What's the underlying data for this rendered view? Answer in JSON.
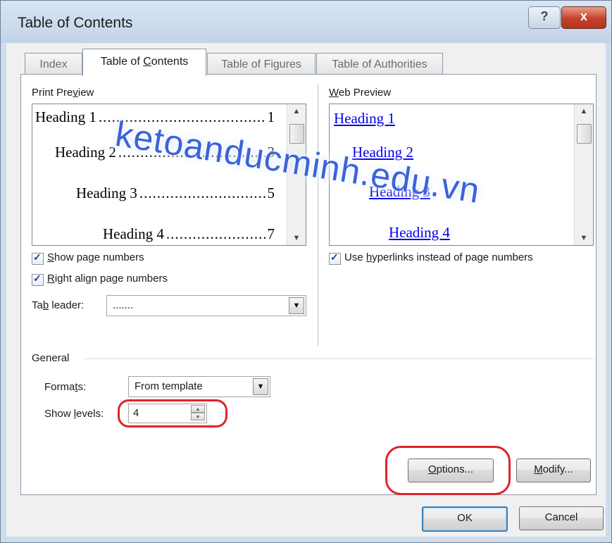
{
  "window": {
    "title": "Table of Contents",
    "help_glyph": "?",
    "close_glyph": "x"
  },
  "tabs": [
    {
      "label": "Index",
      "active": false
    },
    {
      "label_pre": "Table of ",
      "label_acc": "C",
      "label_post": "ontents",
      "active": true
    },
    {
      "label": "Table of Figures",
      "active": false
    },
    {
      "label": "Table of Authorities",
      "active": false
    }
  ],
  "print_preview": {
    "label_pre": "Print Pre",
    "label_acc": "v",
    "label_post": "iew",
    "rows": [
      {
        "text": "Heading 1",
        "dots": "...............................................",
        "page": "1"
      },
      {
        "text": "Heading 2",
        "dots": "...............................................",
        "page": "3"
      },
      {
        "text": "Heading 3",
        "dots": "...............................................",
        "page": "5"
      },
      {
        "text": "Heading 4",
        "dots": "...............................................",
        "page": "7"
      }
    ]
  },
  "web_preview": {
    "label_acc": "W",
    "label_post": "eb Preview",
    "rows": [
      "Heading 1",
      "Heading 2",
      "Heading 3",
      "Heading 4"
    ]
  },
  "options": {
    "show_page_numbers": {
      "acc": "S",
      "rest": "how page numbers",
      "checked": true
    },
    "right_align": {
      "acc": "R",
      "rest": "ight align page numbers",
      "checked": true
    },
    "use_hyperlinks": {
      "pre": "Use ",
      "acc": "h",
      "rest": "yperlinks instead of page numbers",
      "checked": true
    },
    "check_glyph": "✓",
    "tab_leader": {
      "pre": "Ta",
      "acc": "b",
      "post": " leader:",
      "value": "......."
    }
  },
  "general": {
    "legend": "General",
    "formats": {
      "pre": "Forma",
      "acc": "t",
      "post": "s:",
      "value": "From template"
    },
    "show_levels": {
      "pre": "Show ",
      "acc": "l",
      "post": "evels:",
      "value": "4"
    }
  },
  "buttons": {
    "options": {
      "acc": "O",
      "rest": "ptions..."
    },
    "modify": {
      "acc": "M",
      "rest": "odify..."
    },
    "ok": "OK",
    "cancel": "Cancel"
  },
  "icons": {
    "dropdown_arrow": "▼",
    "scroll_up": "▲",
    "scroll_down": "▼",
    "spin_up": "▲",
    "spin_down": "▼"
  },
  "watermark": "ketoanducminh.edu.vn",
  "colors": {
    "link": "#0000ee",
    "highlight": "#e0222a",
    "watermark": "#3c63d8",
    "window_frame": "#cfdcec"
  }
}
